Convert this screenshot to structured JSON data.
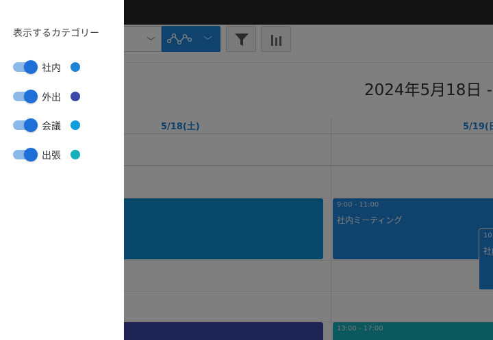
{
  "drawer": {
    "title": "表示するカテゴリー",
    "categories": [
      {
        "label": "社内",
        "on": true,
        "color": "#1e84d8"
      },
      {
        "label": "外出",
        "on": true,
        "color": "#3b49a8"
      },
      {
        "label": "会議",
        "on": true,
        "color": "#0f9fde"
      },
      {
        "label": "出張",
        "on": true,
        "color": "#16b0bc"
      }
    ]
  },
  "header": {
    "date_title": "2024年5月18日 -"
  },
  "calendar": {
    "days": [
      "5/18(土)",
      "5/19(日"
    ],
    "events": [
      {
        "time": "9:00 - 11:00",
        "title": "社内ミーティング",
        "color": "#1e84d8"
      },
      {
        "time": "10:",
        "title": "社内",
        "color": "#1e84d8"
      },
      {
        "time": "13:00 - 17:00",
        "title": "",
        "color": "#16b0bc"
      }
    ]
  },
  "colors": {
    "accent": "#1e84d8",
    "topbar": "#262626"
  }
}
